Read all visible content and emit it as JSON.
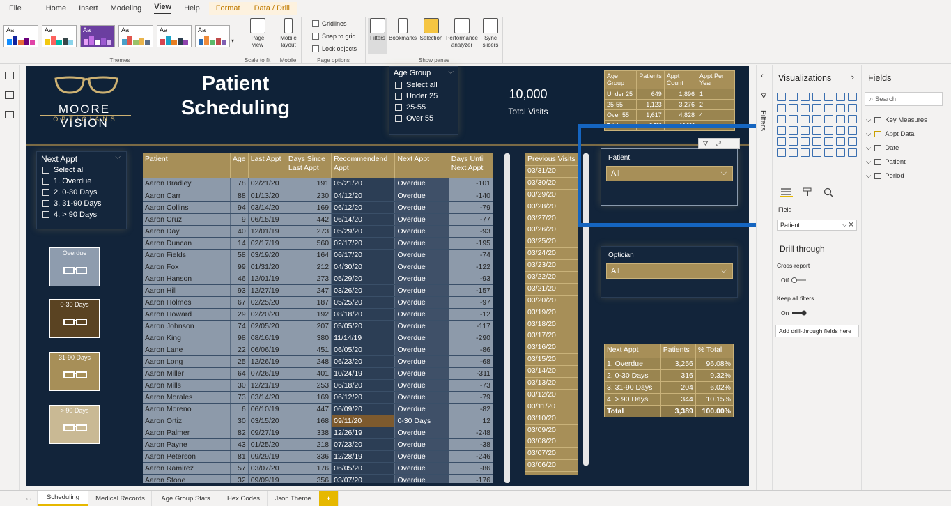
{
  "menu": {
    "file": "File",
    "home": "Home",
    "insert": "Insert",
    "modeling": "Modeling",
    "view": "View",
    "help": "Help",
    "format": "Format",
    "data_drill": "Data / Drill"
  },
  "ribbon": {
    "themes_label": "Themes",
    "theme_aa": "Aa",
    "page_view": "Page view",
    "mobile_layout": "Mobile layout",
    "scale_label": "Scale to fit",
    "mobile_label": "Mobile",
    "gridlines": "Gridlines",
    "snap": "Snap to grid",
    "lock": "Lock objects",
    "page_options_label": "Page options",
    "filters": "Filters",
    "bookmarks": "Bookmarks",
    "selection": "Selection",
    "performance": "Performance analyzer",
    "sync": "Sync slicers",
    "show_panes_label": "Show panes"
  },
  "report": {
    "logo_name": "MOORE VISION",
    "logo_sub": "OPTICIANS",
    "title": "Patient Scheduling",
    "age_slicer": {
      "title": "Age Group",
      "items": [
        "Select all",
        "Under 25",
        "25-55",
        "Over 55"
      ]
    },
    "kpi": {
      "value": "10,000",
      "label": "Total Visits"
    },
    "age_table": {
      "headers": [
        "Age Group",
        "Patients",
        "Appt Count",
        "Appt Per Year"
      ],
      "rows": [
        [
          "Under 25",
          "649",
          "1,896",
          "1"
        ],
        [
          "25-55",
          "1,123",
          "3,276",
          "2"
        ],
        [
          "Over 55",
          "1,617",
          "4,828",
          "4"
        ]
      ],
      "total": [
        "Total",
        "3,389",
        "10,000",
        ""
      ]
    },
    "next_slicer": {
      "title": "Next Appt",
      "items": [
        "Select all",
        "1. Overdue",
        "2. 0-30 Days",
        "3. 31-90 Days",
        "4. > 90 Days"
      ]
    },
    "legend": [
      "Overdue",
      "0-30 Days",
      "31-90 Days",
      "> 90 Days"
    ],
    "patient_table": {
      "headers": [
        "Patient",
        "Age",
        "Last Appt",
        "Days Since Last Appt",
        "Recommendend Appt",
        "Next Appt",
        "Days Until Next Appt"
      ],
      "rows": [
        [
          "Aaron Bradley",
          "78",
          "02/21/20",
          "191",
          "05/21/20",
          "Overdue",
          "-101"
        ],
        [
          "Aaron Carr",
          "88",
          "01/13/20",
          "230",
          "04/12/20",
          "Overdue",
          "-140"
        ],
        [
          "Aaron Collins",
          "94",
          "03/14/20",
          "169",
          "06/12/20",
          "Overdue",
          "-79"
        ],
        [
          "Aaron Cruz",
          "9",
          "06/15/19",
          "442",
          "06/14/20",
          "Overdue",
          "-77"
        ],
        [
          "Aaron Day",
          "40",
          "12/01/19",
          "273",
          "05/29/20",
          "Overdue",
          "-93"
        ],
        [
          "Aaron Duncan",
          "14",
          "02/17/19",
          "560",
          "02/17/20",
          "Overdue",
          "-195"
        ],
        [
          "Aaron Fields",
          "58",
          "03/19/20",
          "164",
          "06/17/20",
          "Overdue",
          "-74"
        ],
        [
          "Aaron Fox",
          "99",
          "01/31/20",
          "212",
          "04/30/20",
          "Overdue",
          "-122"
        ],
        [
          "Aaron Hanson",
          "46",
          "12/01/19",
          "273",
          "05/29/20",
          "Overdue",
          "-93"
        ],
        [
          "Aaron Hill",
          "93",
          "12/27/19",
          "247",
          "03/26/20",
          "Overdue",
          "-157"
        ],
        [
          "Aaron Holmes",
          "67",
          "02/25/20",
          "187",
          "05/25/20",
          "Overdue",
          "-97"
        ],
        [
          "Aaron Howard",
          "29",
          "02/20/20",
          "192",
          "08/18/20",
          "Overdue",
          "-12"
        ],
        [
          "Aaron Johnson",
          "74",
          "02/05/20",
          "207",
          "05/05/20",
          "Overdue",
          "-117"
        ],
        [
          "Aaron King",
          "98",
          "08/16/19",
          "380",
          "11/14/19",
          "Overdue",
          "-290"
        ],
        [
          "Aaron Lane",
          "22",
          "06/06/19",
          "451",
          "06/05/20",
          "Overdue",
          "-86"
        ],
        [
          "Aaron Long",
          "25",
          "12/26/19",
          "248",
          "06/23/20",
          "Overdue",
          "-68"
        ],
        [
          "Aaron Miller",
          "64",
          "07/26/19",
          "401",
          "10/24/19",
          "Overdue",
          "-311"
        ],
        [
          "Aaron Mills",
          "30",
          "12/21/19",
          "253",
          "06/18/20",
          "Overdue",
          "-73"
        ],
        [
          "Aaron Morales",
          "73",
          "03/14/20",
          "169",
          "06/12/20",
          "Overdue",
          "-79"
        ],
        [
          "Aaron Moreno",
          "6",
          "06/10/19",
          "447",
          "06/09/20",
          "Overdue",
          "-82"
        ],
        [
          "Aaron Ortiz",
          "30",
          "03/15/20",
          "168",
          "09/11/20",
          "0-30 Days",
          "12"
        ],
        [
          "Aaron Palmer",
          "82",
          "09/27/19",
          "338",
          "12/26/19",
          "Overdue",
          "-248"
        ],
        [
          "Aaron Payne",
          "43",
          "01/25/20",
          "218",
          "07/23/20",
          "Overdue",
          "-38"
        ],
        [
          "Aaron Peterson",
          "81",
          "09/29/19",
          "336",
          "12/28/19",
          "Overdue",
          "-246"
        ],
        [
          "Aaron Ramirez",
          "57",
          "03/07/20",
          "176",
          "06/05/20",
          "Overdue",
          "-86"
        ],
        [
          "Aaron Stone",
          "32",
          "09/09/19",
          "356",
          "03/07/20",
          "Overdue",
          "-176"
        ]
      ]
    },
    "prev_visits": {
      "header": "Previous Visits",
      "values": [
        "03/31/20",
        "03/30/20",
        "03/29/20",
        "03/28/20",
        "03/27/20",
        "03/26/20",
        "03/25/20",
        "03/24/20",
        "03/23/20",
        "03/22/20",
        "03/21/20",
        "03/20/20",
        "03/19/20",
        "03/18/20",
        "03/17/20",
        "03/16/20",
        "03/15/20",
        "03/14/20",
        "03/13/20",
        "03/12/20",
        "03/11/20",
        "03/10/20",
        "03/09/20",
        "03/08/20",
        "03/07/20",
        "03/06/20"
      ]
    },
    "patient_dd": {
      "title": "Patient",
      "value": "All"
    },
    "optician_dd": {
      "title": "Optician",
      "value": "All"
    },
    "next_table": {
      "headers": [
        "Next Appt",
        "Patients",
        "% Total"
      ],
      "rows": [
        [
          "1. Overdue",
          "3,256",
          "96.08%"
        ],
        [
          "2. 0-30 Days",
          "316",
          "9.32%"
        ],
        [
          "3. 31-90 Days",
          "204",
          "6.02%"
        ],
        [
          "4. > 90 Days",
          "344",
          "10.15%"
        ]
      ],
      "total": [
        "Total",
        "3,389",
        "100.00%"
      ]
    }
  },
  "panes": {
    "filters": "Filters",
    "viz": "Visualizations",
    "fields": "Fields",
    "search": "Search",
    "field_label": "Field",
    "field_well": "Patient",
    "drill_title": "Drill through",
    "cross_report": "Cross-report",
    "off": "Off",
    "keep_filters": "Keep all filters",
    "on": "On",
    "add_drill": "Add drill-through fields here",
    "field_tables": [
      "Key Measures",
      "Appt Data",
      "Date",
      "Patient",
      "Period"
    ]
  },
  "tabs": [
    "Scheduling",
    "Medical Records",
    "Age Group Stats",
    "Hex Codes",
    "Json Theme"
  ],
  "colors": {
    "gold": "#a78f58",
    "navy": "#12243a",
    "selection": "#1565c0"
  }
}
